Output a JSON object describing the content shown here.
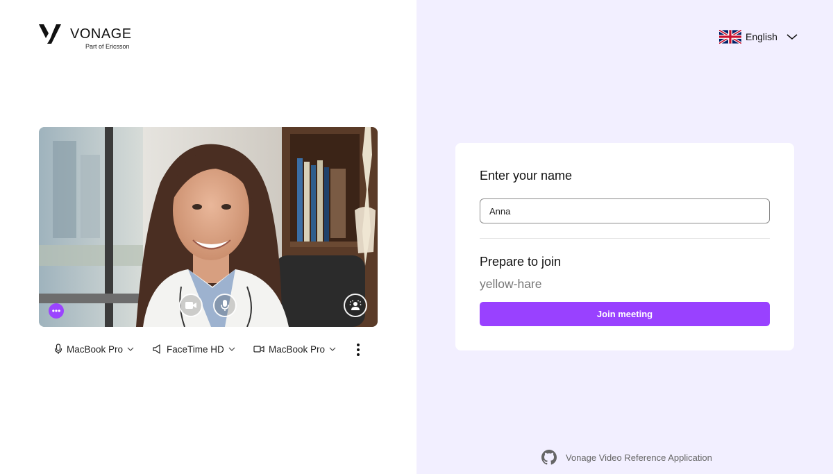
{
  "brand": {
    "wordmark": "VONAGE",
    "tagline": "Part of Ericsson",
    "accent_color": "#9941ff",
    "icon": "vonage-logo"
  },
  "language": {
    "selected": "English",
    "flag_icon": "uk-flag-icon",
    "dropdown_icon": "chevron-down-icon"
  },
  "preview": {
    "controls": [
      {
        "name": "camera-toggle",
        "icon": "video-camera-icon"
      },
      {
        "name": "microphone-toggle",
        "icon": "microphone-icon"
      },
      {
        "name": "background-effects",
        "icon": "person-background-icon"
      }
    ],
    "more_icon": "ellipsis-icon"
  },
  "devices": [
    {
      "label": "MacBook Pro",
      "icon": "microphone-icon"
    },
    {
      "label": "FaceTime HD",
      "icon": "speaker-icon"
    },
    {
      "label": "MacBook Pro",
      "icon": "video-camera-icon"
    }
  ],
  "form": {
    "name_title": "Enter your name",
    "name_value": "Anna",
    "prepare_title": "Prepare to join",
    "room_name": "yellow-hare",
    "join_label": "Join meeting"
  },
  "footer": {
    "icon": "github-icon",
    "label": "Vonage Video Reference Application"
  }
}
